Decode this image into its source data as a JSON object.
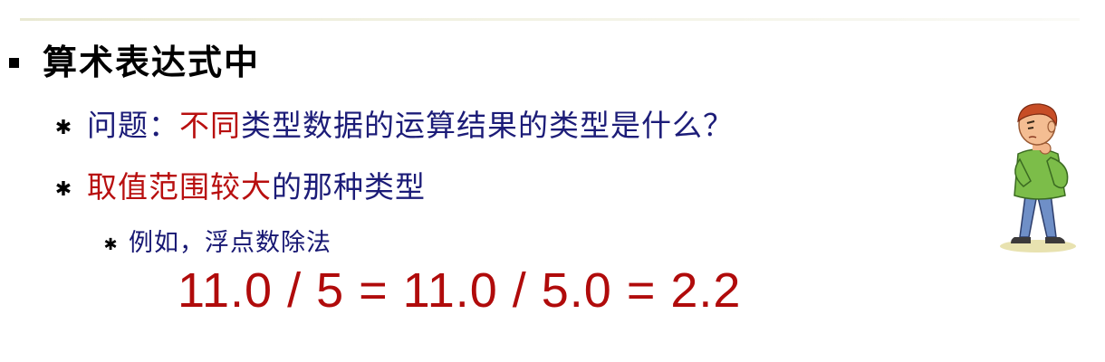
{
  "heading": "算术表达式中",
  "bullet1": {
    "prefix": "问题：",
    "highlight": "不同",
    "suffix": "类型数据的运算结果的类型是什么？"
  },
  "bullet2": {
    "highlight": "取值范围较大",
    "suffix": "的那种类型"
  },
  "bullet3": {
    "text": "例如，浮点数除法"
  },
  "equation": "11.0 / 5 = 11.0 / 5.0 = 2.2",
  "colors": {
    "navy_text": "#1c1c78",
    "red_text": "#b80f0f",
    "equation": "#b00b0b"
  },
  "icons": {
    "heading_bullet": "square-bullet",
    "list_bullet": "asterisk",
    "illustration": "thinking-cartoon-boy"
  }
}
